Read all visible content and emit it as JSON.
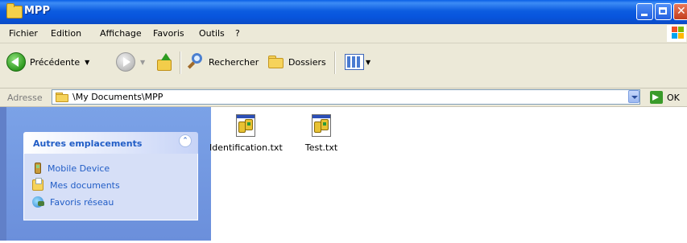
{
  "window": {
    "title": "MPP"
  },
  "menu": {
    "items": [
      {
        "label": "Fichier"
      },
      {
        "label": "Edition"
      },
      {
        "label": "Affichage"
      },
      {
        "label": "Favoris"
      },
      {
        "label": "Outils"
      },
      {
        "label": "?"
      }
    ]
  },
  "toolbar": {
    "back_label": "Précédente",
    "search_label": "Rechercher",
    "folders_label": "Dossiers"
  },
  "address": {
    "label": "Adresse",
    "path": "\\My Documents\\MPP",
    "go_label": "OK"
  },
  "taskpane": {
    "group_title": "Autres emplacements",
    "places": [
      {
        "label": "Mobile Device",
        "icon": "mobile-device-icon"
      },
      {
        "label": "Mes documents",
        "icon": "my-documents-icon"
      },
      {
        "label": "Favoris réseau",
        "icon": "network-places-icon"
      }
    ]
  },
  "files": [
    {
      "name": "Identification.txt",
      "icon": "text-file-icon"
    },
    {
      "name": "Test.txt",
      "icon": "text-file-icon"
    }
  ],
  "colors": {
    "titlebar": "#0a5fe6",
    "taskpane": "#7ba2e7",
    "link": "#215dc6",
    "chrome": "#ece9d8"
  }
}
